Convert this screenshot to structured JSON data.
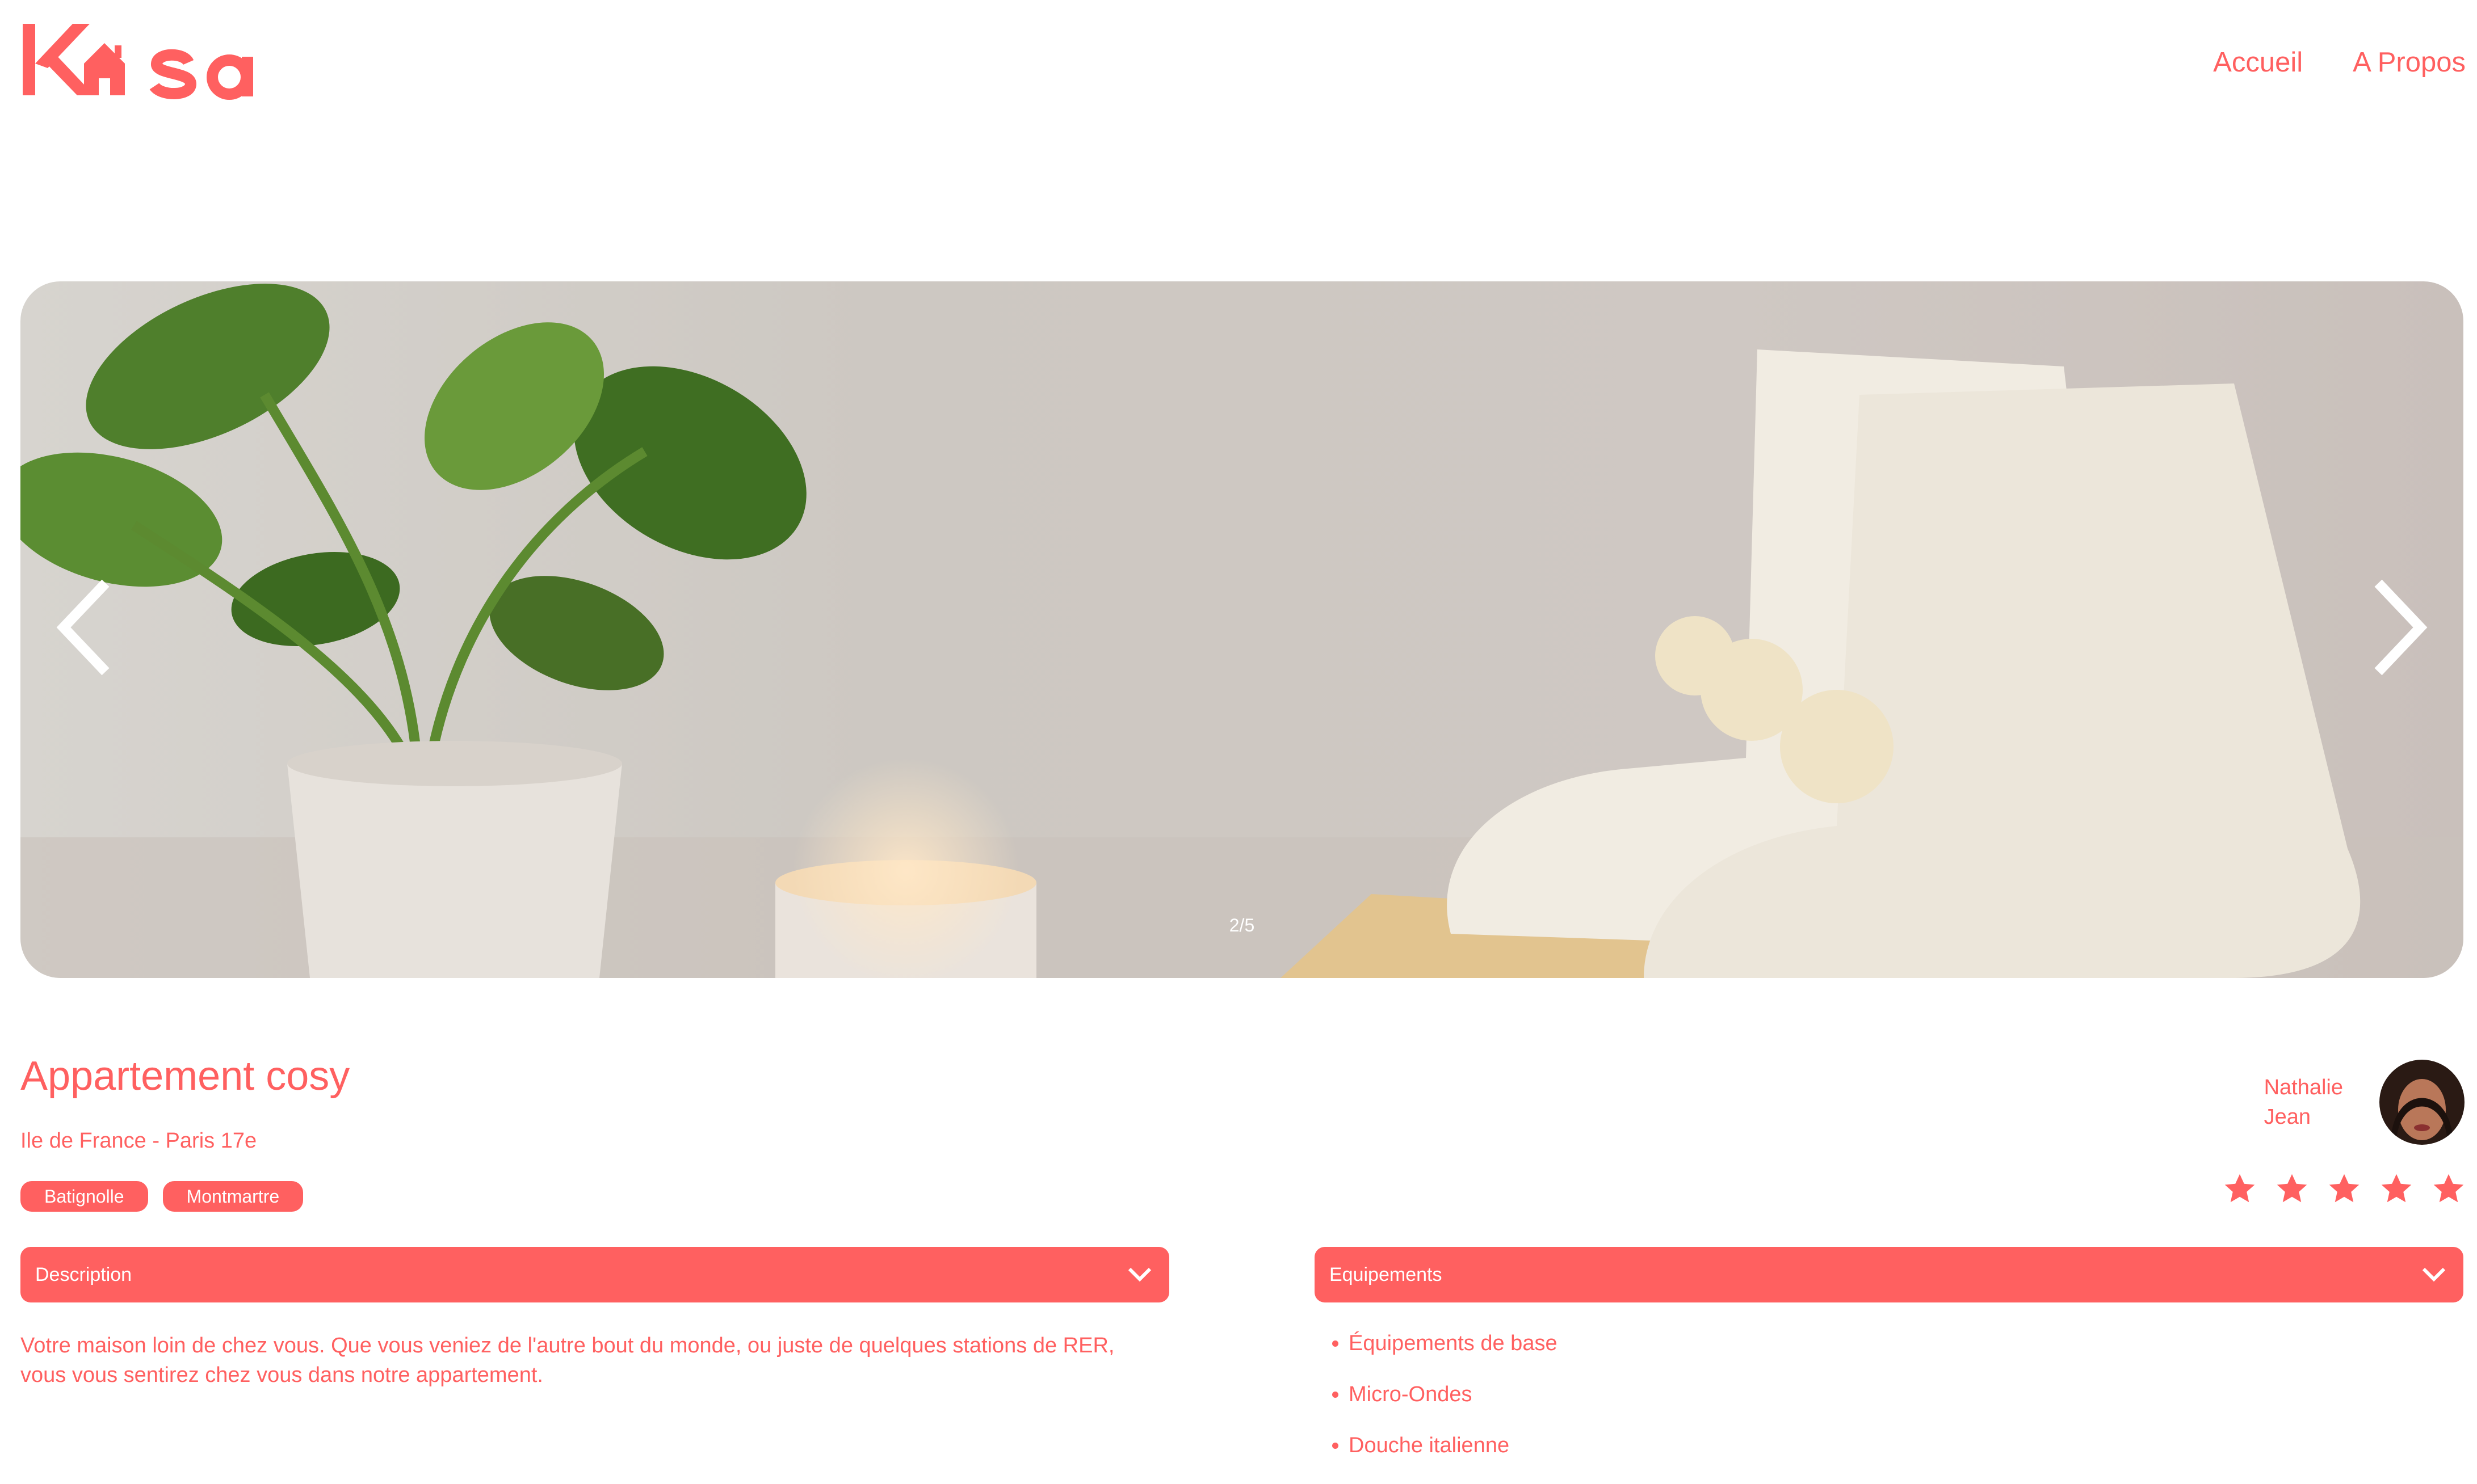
{
  "logo": {
    "text": "Kasa"
  },
  "nav": {
    "home": "Accueil",
    "about": "A Propos"
  },
  "carousel": {
    "counter": "2/5"
  },
  "listing": {
    "title": "Appartement cosy",
    "location": "Ile de France - Paris 17e",
    "tags": [
      "Batignolle",
      "Montmartre"
    ],
    "host": {
      "first_name": "Nathalie",
      "last_name": "Jean"
    },
    "rating": 5,
    "rating_max": 5
  },
  "description": {
    "label": "Description",
    "text": "Votre maison loin de chez vous. Que vous veniez de l'autre bout du monde, ou juste de quelques stations de RER, vous vous sentirez chez vous dans notre appartement."
  },
  "equipments": {
    "label": "Equipements",
    "items": [
      "Équipements de base",
      "Micro-Ondes",
      "Douche italienne"
    ]
  },
  "colors": {
    "accent": "#ff6060",
    "star_inactive": "#e3e3e3"
  }
}
